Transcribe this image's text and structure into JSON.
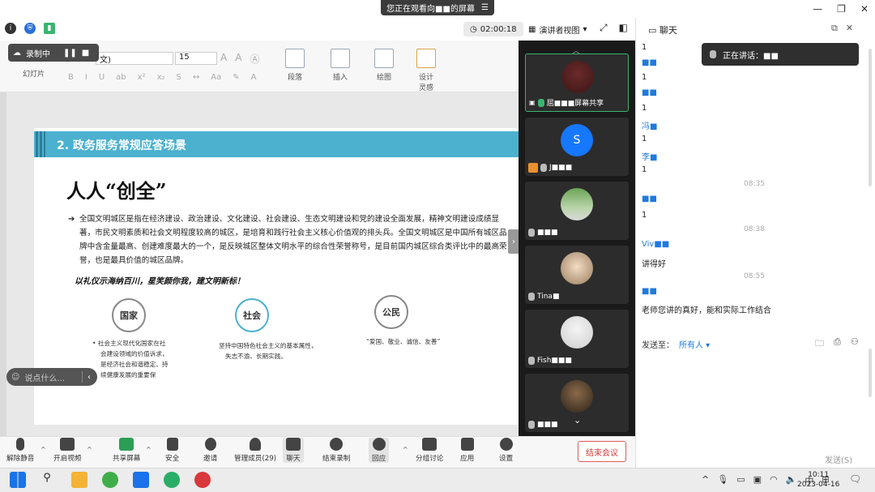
{
  "share_banner": {
    "text": "您正在观看向■■的屏幕"
  },
  "top": {
    "timer": "02:00:18",
    "view_mode": "演讲者视图",
    "chat_title": "聊天"
  },
  "recording": {
    "label": "录制中"
  },
  "ribbon": {
    "font_name": "文)",
    "font_size": "15",
    "groups": [
      "幻灯片",
      "段落",
      "插入",
      "绘图",
      "设计灵感"
    ],
    "design_line1": "设计",
    "design_line2": "灵感"
  },
  "slide": {
    "header": "2. 政务服务常规应答场景",
    "title": "人人“创全”",
    "bullet_arrow": "➔",
    "paragraph": "全国文明城区是指在经济建设、政治建设、文化建设、社会建设、生态文明建设和党的建设全面发展，精神文明建设成绩显著，市民文明素质和社会文明程度较高的城区，是培育和践行社会主义核心价值观的排头兵。全国文明城区是中国所有城区品牌中含金量最高、创建难度最大的一个，是反映城区整体文明水平的综合性荣誉称号，是目前国内城区综合类评比中的最高荣誉，也是最具价值的城区品牌。",
    "slogan": "以礼仪示海纳百川，星笑颜你我，建文明新标！",
    "circles": [
      "国家",
      "社会",
      "公民"
    ],
    "captions": [
      [
        "社会主义现代化国家在社",
        "会建设领域的价值诉求，",
        "是经济社会和谐稳定、持",
        "续健康发展的重要保"
      ],
      [
        "坚持中国特色社会主义的基本属性，",
        "失志不渝、长期实践。"
      ],
      [
        "“爱国、敬业、诚信、友善”"
      ]
    ]
  },
  "say_bar": {
    "placeholder": "说点什么..."
  },
  "video_tiles": [
    {
      "name": "屈■■■屏幕共享",
      "mic": "on",
      "avatar": "photo"
    },
    {
      "name": "J■■■",
      "mic": "off",
      "avatar": "S"
    },
    {
      "name": "■■■",
      "mic": "off",
      "avatar": "photo"
    },
    {
      "name": "Tina■",
      "mic": "off",
      "avatar": "photo"
    },
    {
      "name": "Fish■■■",
      "mic": "off",
      "avatar": "photo"
    },
    {
      "name": "■■■",
      "mic": "off",
      "avatar": "photo"
    }
  ],
  "chat": {
    "speaking_label": "正在讲话：■■",
    "messages": [
      {
        "kind": "msg",
        "text": "1"
      },
      {
        "kind": "name",
        "text": "■■"
      },
      {
        "kind": "msg",
        "text": "1"
      },
      {
        "kind": "name",
        "text": "■■"
      },
      {
        "kind": "msg",
        "text": "1"
      },
      {
        "kind": "name",
        "text": "冯■"
      },
      {
        "kind": "msg",
        "text": "1"
      },
      {
        "kind": "name",
        "text": "李■"
      },
      {
        "kind": "msg",
        "text": "1"
      },
      {
        "kind": "time",
        "text": "08:35"
      },
      {
        "kind": "name",
        "text": "■■"
      },
      {
        "kind": "msg",
        "text": "1"
      },
      {
        "kind": "time",
        "text": "08:38"
      },
      {
        "kind": "name",
        "text": "Viv■■"
      },
      {
        "kind": "msg",
        "text": "讲得好"
      },
      {
        "kind": "time",
        "text": "08:55"
      },
      {
        "kind": "name",
        "text": "■■"
      },
      {
        "kind": "msg",
        "text": "老师您讲的真好，能和实际工作结合"
      }
    ],
    "send_to_label": "发送至：",
    "send_to_target": "所有人 ▾",
    "send_button": "发送(S)"
  },
  "toolbar": {
    "items": [
      "解除静音",
      "开启视频",
      "共享屏幕",
      "安全",
      "邀请",
      "管理成员(29)",
      "聊天",
      "结束录制",
      "回应",
      "分组讨论",
      "应用",
      "设置"
    ],
    "end_meeting": "结束会议"
  },
  "taskbar": {
    "ime": "中",
    "time": "10:11",
    "date": "2023-04-16"
  },
  "colors": {
    "slide_header": "#4bb1cf",
    "active_speaker_border": "#39b56f",
    "end_meeting": "#d23b3b",
    "chat_name": "#1f7ae0"
  }
}
